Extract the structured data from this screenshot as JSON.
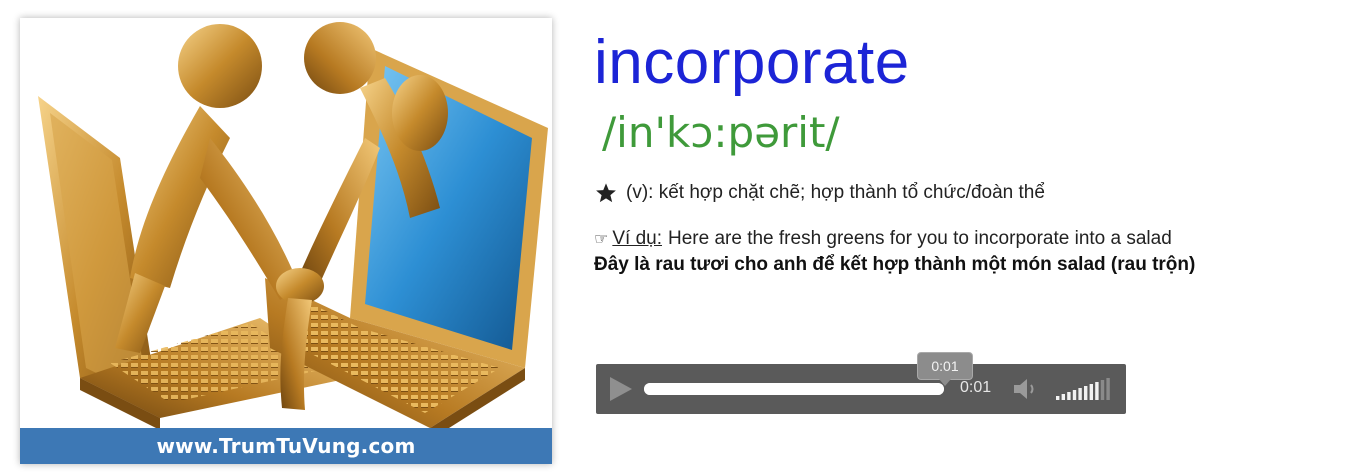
{
  "image": {
    "watermark": "www.TrumTuVung.com",
    "colors": {
      "gold": "#c58a2c",
      "screen_blue": "#2d8fd4",
      "bar_blue": "#3d78b5"
    }
  },
  "entry": {
    "word": "incorporate",
    "phonetic": "/in'kɔ:pərit/",
    "meaning_icon": "star-icon",
    "meaning": "(v): kết hợp chặt chẽ; hợp thành tổ chức/đoàn thể",
    "example_icon": "pointing-hand-icon",
    "example_label": "Ví dụ:",
    "example_text": "Here are the fresh greens for you to incorporate into a salad",
    "translation": "Đây là rau tươi cho anh để kết hợp thành một món salad (rau trộn)"
  },
  "player": {
    "play_icon": "play-icon",
    "tooltip_time": "0:01",
    "current_time": "0:01",
    "progress_fraction": 1.0,
    "volume_icon": "speaker-icon",
    "volume_level": 0.8
  },
  "colors": {
    "word": "#1c24d6",
    "phonetic": "#3f9a3a",
    "player_bg": "#5a5a5a"
  }
}
